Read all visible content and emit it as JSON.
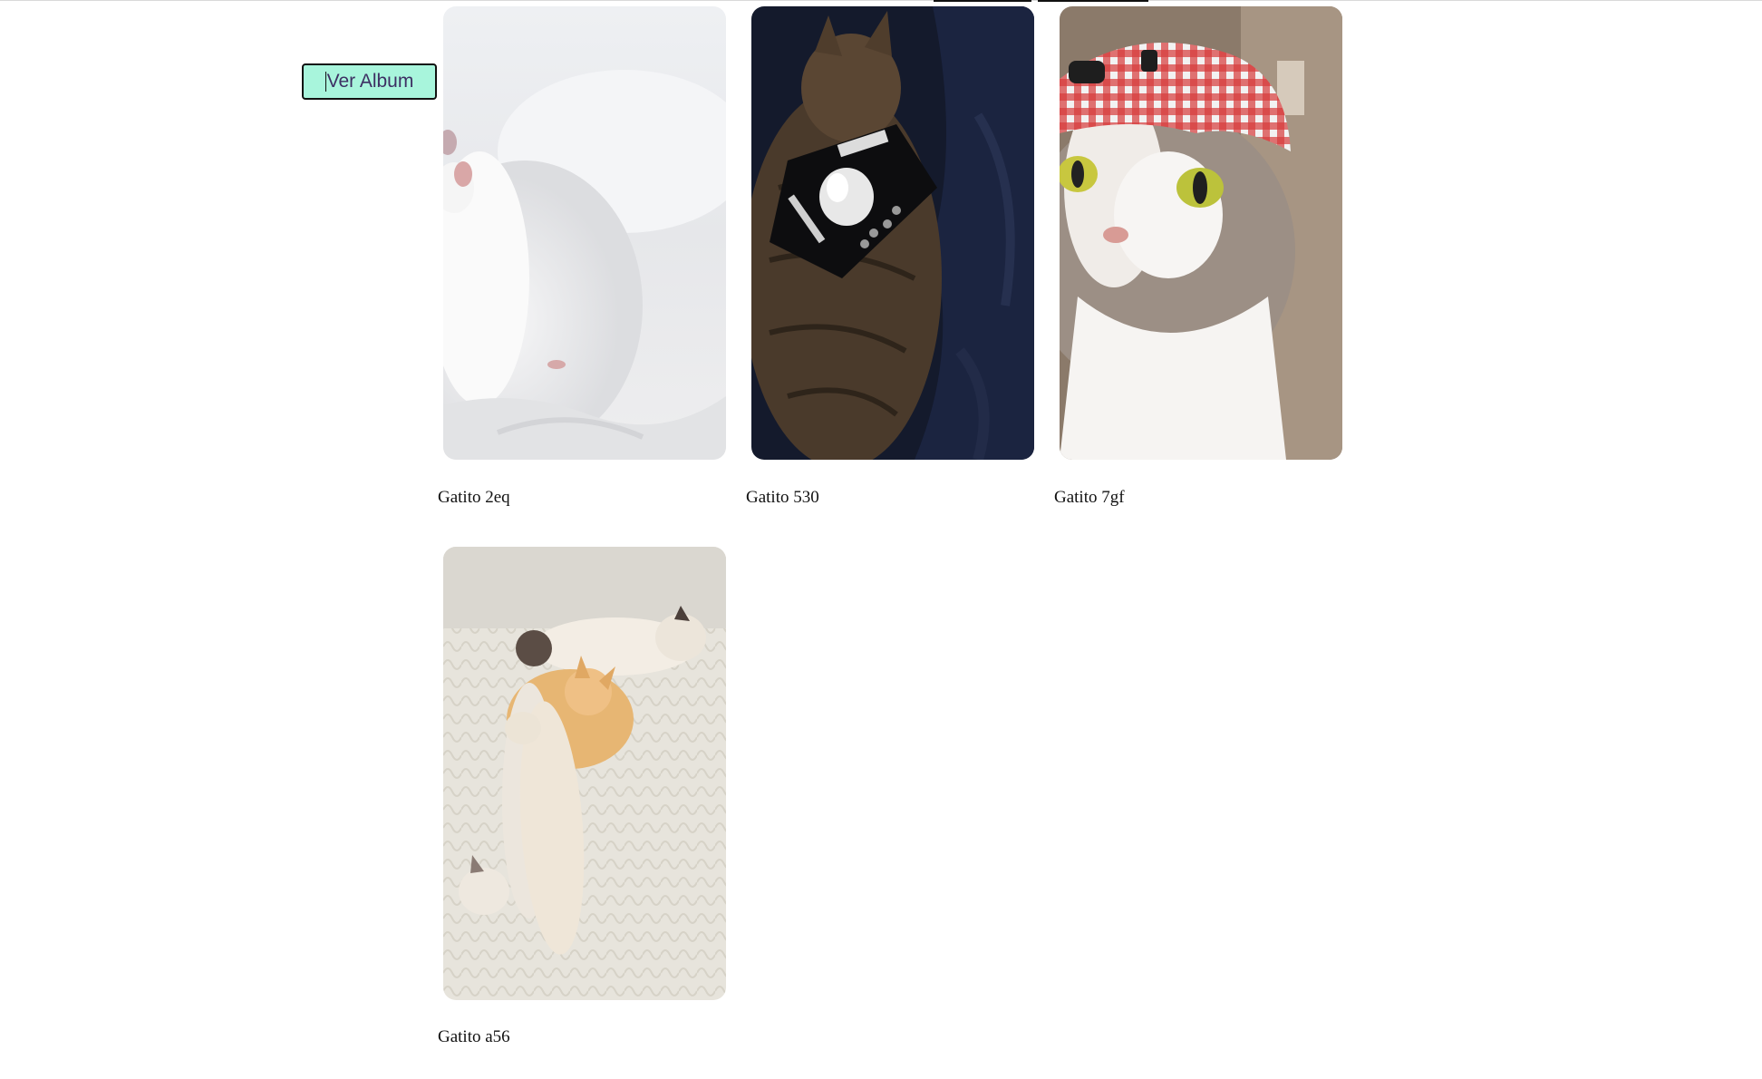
{
  "toolbar": {
    "ver_album_label": "Ver Album"
  },
  "gallery": {
    "items": [
      {
        "caption": "Gatito 2eq",
        "photo": "white-kitten-on-bedsheet"
      },
      {
        "caption": "Gatito 530",
        "photo": "tabby-cat-on-dark-blanket"
      },
      {
        "caption": "Gatito 7gf",
        "photo": "cat-with-red-gingham-hat"
      },
      {
        "caption": "Gatito a56",
        "photo": "kittens-sleeping-on-blanket"
      }
    ]
  },
  "colors": {
    "button_bg": "#a8f5dc",
    "button_border": "#111111",
    "button_text": "#3d2f63"
  }
}
